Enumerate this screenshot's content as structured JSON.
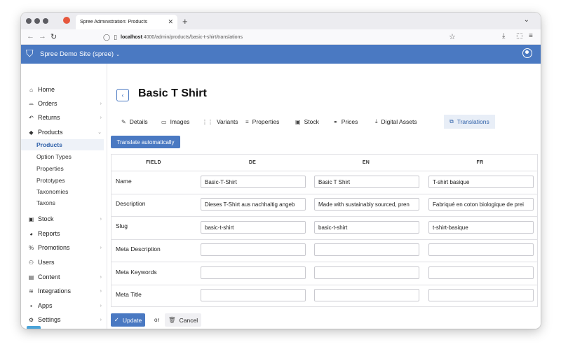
{
  "browser": {
    "tab_title": "Spree Administration: Products",
    "url_host": "localhost",
    "url_rest": ":4000/admin/products/basic-t-shirt/translations"
  },
  "header": {
    "site_name": "Spree Demo Site (spree)",
    "brand_color": "#4a79c2"
  },
  "sidebar": {
    "items": [
      {
        "label": "Home",
        "icon": "home-icon",
        "has_arrow": false
      },
      {
        "label": "Orders",
        "icon": "inbox-icon",
        "has_arrow": true
      },
      {
        "label": "Returns",
        "icon": "return-icon",
        "has_arrow": true
      },
      {
        "label": "Products",
        "icon": "tag-icon",
        "has_arrow": true
      }
    ],
    "product_subitems": [
      "Products",
      "Option Types",
      "Properties",
      "Prototypes",
      "Taxonomies",
      "Taxons"
    ],
    "items2": [
      {
        "label": "Stock",
        "icon": "box-icon",
        "has_arrow": true
      },
      {
        "label": "Reports",
        "icon": "chart-pie-icon",
        "has_arrow": false
      },
      {
        "label": "Promotions",
        "icon": "percent-icon",
        "has_arrow": true
      },
      {
        "label": "Users",
        "icon": "users-icon",
        "has_arrow": false
      },
      {
        "label": "Content",
        "icon": "content-icon",
        "has_arrow": true
      },
      {
        "label": "Integrations",
        "icon": "layers-icon",
        "has_arrow": true
      },
      {
        "label": "Apps",
        "icon": "terminal-icon",
        "has_arrow": true
      },
      {
        "label": "Settings",
        "icon": "gear-icon",
        "has_arrow": true
      }
    ]
  },
  "main": {
    "title": "Basic T Shirt",
    "tabs": [
      {
        "label": "Details",
        "icon": "pencil-icon"
      },
      {
        "label": "Images",
        "icon": "image-icon"
      },
      {
        "label": "Variants",
        "icon": "variants-icon"
      },
      {
        "label": "Properties",
        "icon": "list-icon"
      },
      {
        "label": "Stock",
        "icon": "box-icon"
      },
      {
        "label": "Prices",
        "icon": "prices-icon"
      },
      {
        "label": "Digital Assets",
        "icon": "download-icon"
      },
      {
        "label": "Translations",
        "icon": "translate-icon"
      }
    ],
    "active_tab": "Translations",
    "translate_button": "Translate automatically",
    "table": {
      "headers": [
        "FIELD",
        "DE",
        "EN",
        "FR"
      ],
      "rows": [
        {
          "field": "Name",
          "de": "Basic-T-Shirt",
          "en": "Basic T Shirt",
          "fr": "T-shirt basique"
        },
        {
          "field": "Description",
          "de": "Dieses T-Shirt aus nachhaltig angeb",
          "en": "Made with sustainably sourced, pren",
          "fr": "Fabriqué en coton biologique de prei"
        },
        {
          "field": "Slug",
          "de": "basic-t-shirt",
          "en": "basic-t-shirt",
          "fr": "t-shirt-basique"
        },
        {
          "field": "Meta Description",
          "de": "",
          "en": "",
          "fr": ""
        },
        {
          "field": "Meta Keywords",
          "de": "",
          "en": "",
          "fr": ""
        },
        {
          "field": "Meta Title",
          "de": "",
          "en": "",
          "fr": ""
        }
      ]
    },
    "update_label": "Update",
    "or_text": "or",
    "cancel_label": "Cancel"
  }
}
